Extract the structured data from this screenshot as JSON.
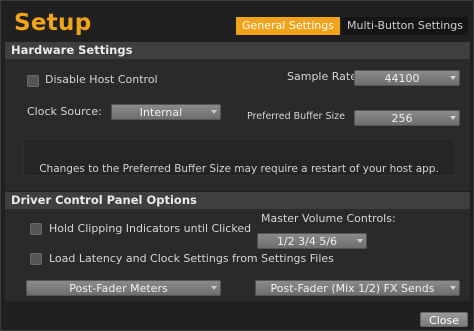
{
  "title": "Setup",
  "tabs": {
    "general": "General Settings",
    "multi": "Multi-Button Settings"
  },
  "hardware": {
    "heading": "Hardware Settings",
    "disable_host_control": "Disable Host Control",
    "sample_rate_label": "Sample Rate",
    "sample_rate_value": "44100",
    "clock_source_label": "Clock Source:",
    "clock_source_value": "Internal",
    "buffer_label": "Preferred Buffer Size",
    "buffer_value": "256",
    "note": "Changes to the Preferred Buffer Size may require a restart of your host app."
  },
  "driver": {
    "heading": "Driver Control Panel Options",
    "hold_clipping": "Hold Clipping Indicators until Clicked",
    "master_volume_label": "Master Volume Controls:",
    "master_volume_value": "1/2  3/4  5/6",
    "load_latency": "Load Latency and Clock Settings from Settings Files",
    "meters_value": "Post-Fader Meters",
    "fx_sends_value": "Post-Fader (Mix 1/2) FX Sends"
  },
  "close_label": "Close",
  "colors": {
    "accent": "#f1a31a",
    "background": "#202020",
    "section_bar": "#3f3f3f"
  }
}
